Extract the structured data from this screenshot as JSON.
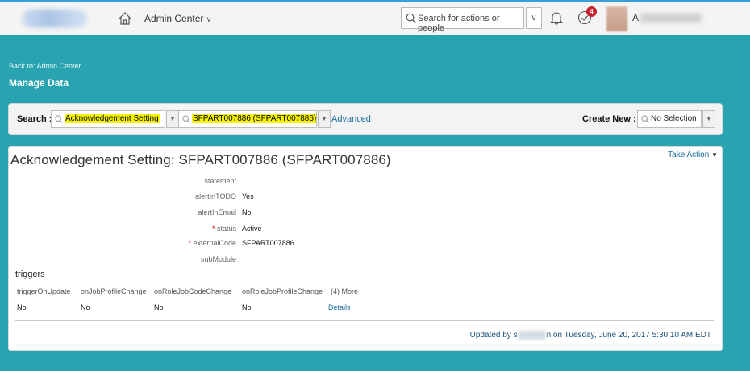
{
  "header": {
    "nav_label": "Admin Center",
    "search_placeholder": "Search for actions or people",
    "todo_count": "4",
    "user_initial": "A"
  },
  "page": {
    "back_link": "Back to: Admin Center",
    "title": "Manage Data"
  },
  "search_bar": {
    "label": "Search :",
    "object_type": "Acknowledgement Setting",
    "object_instance": "SFPART007886 (SFPART007886)",
    "advanced_link": "Advanced",
    "create_new_label": "Create New :",
    "create_new_value": "No Selection"
  },
  "record": {
    "title": "Acknowledgement Setting: SFPART007886 (SFPART007886)",
    "take_action": "Take Action",
    "fields": [
      {
        "label": "statement",
        "value": "",
        "required": false
      },
      {
        "label": "alertInTODO",
        "value": "Yes",
        "required": false
      },
      {
        "label": "alertInEmail",
        "value": "No",
        "required": false
      },
      {
        "label": "status",
        "value": "Active",
        "required": true
      },
      {
        "label": "externalCode",
        "value": "SFPART007886",
        "required": true
      },
      {
        "label": "subModule",
        "value": "",
        "required": false
      }
    ],
    "triggers": {
      "heading": "triggers",
      "columns": [
        "triggerOnUpdate",
        "onJobProfileChange",
        "onRoleJobCodeChange",
        "onRoleJobProfileChange"
      ],
      "more_link": "(4) More",
      "values": [
        "No",
        "No",
        "No",
        "No"
      ],
      "details_link": "Details"
    },
    "updated": {
      "prefix": "Updated by s",
      "suffix": "n on Tuesday, June 20, 2017 5:30:10 AM EDT"
    }
  },
  "colors": {
    "teal_background": "#2aa3b0",
    "link": "#1a6d9c",
    "highlight": "#f5f500",
    "badge": "#c8202c"
  }
}
